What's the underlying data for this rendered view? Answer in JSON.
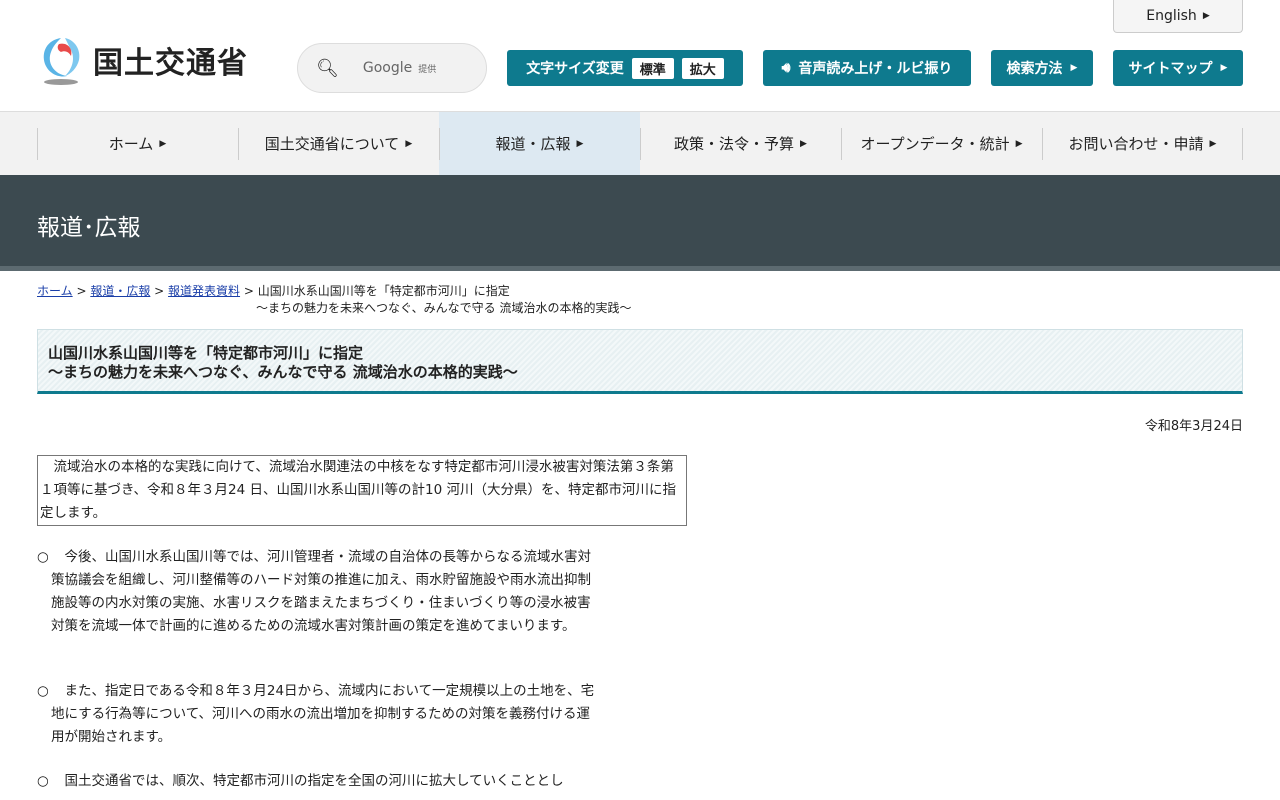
{
  "header": {
    "logo_text": "国土交通省",
    "english": "English",
    "search_label": "Google",
    "search_sub": "提供",
    "font_size": {
      "label": "文字サイズ変更",
      "standard": "標準",
      "large": "拡大"
    },
    "speech": "音声読み上げ・ルビ振り",
    "search_method": "検索方法",
    "sitemap": "サイトマップ"
  },
  "nav": [
    {
      "label": "ホーム"
    },
    {
      "label": "国土交通省について"
    },
    {
      "label": "報道・広報"
    },
    {
      "label": "政策・法令・予算"
    },
    {
      "label": "オープンデータ・統計"
    },
    {
      "label": "お問い合わせ・申請"
    }
  ],
  "banner": {
    "title": "報道･広報"
  },
  "breadcrumb": {
    "home": "ホーム",
    "press": "報道・広報",
    "releases": "報道発表資料",
    "current": "山国川水系山国川等を「特定都市河川」に指定",
    "current_sub": "～まちの魅力を未来へつなぐ、みんなで守る 流域治水の本格的実践～"
  },
  "article": {
    "title": "山国川水系山国川等を「特定都市河川」に指定",
    "subtitle": "～まちの魅力を未来へつなぐ、みんなで守る 流域治水の本格的実践～",
    "date": "令和8年3月24日",
    "lead": "　流域治水の本格的な実践に向けて、流域治水関連法の中核をなす特定都市河川浸水被害対策法第３条第１項等に基づき、令和８年３月24 日、山国川水系山国川等の計10 河川（大分県）を、特定都市河川に指定します。",
    "bullet": "○",
    "paragraphs": [
      "　今後、山国川水系山国川等では、河川管理者・流域の自治体の長等からなる流域水害対策協議会を組織し、河川整備等のハード対策の推進に加え、雨水貯留施設や雨水流出抑制施設等の内水対策の実施、水害リスクを踏まえたまちづくり・住まいづくり等の浸水被害対策を流域一体で計画的に進めるための流域水害対策計画の策定を進めてまいります。",
      "　また、指定日である令和８年３月24日から、流域内において一定規模以上の土地を、宅地にする行為等について、河川への雨水の流出増加を抑制するための対策を義務付ける運用が開始されます。",
      "　国土交通省では、順次、特定都市河川の指定を全国の河川に拡大していくこととし"
    ]
  }
}
